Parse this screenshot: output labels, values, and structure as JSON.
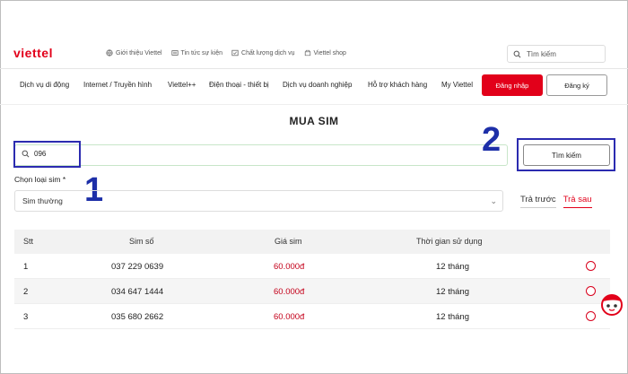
{
  "header": {
    "logo_text": "viettel",
    "top_links": [
      {
        "label": "Giới thiệu Viettel",
        "icon": "globe-icon"
      },
      {
        "label": "Tin tức sự kiện",
        "icon": "news-icon"
      },
      {
        "label": "Chất lượng dịch vụ",
        "icon": "quality-icon"
      },
      {
        "label": "Viettel shop",
        "icon": "shop-icon"
      }
    ],
    "search_placeholder": "Tìm kiếm"
  },
  "nav": {
    "items": [
      "Dịch vụ di động",
      "Internet / Truyền hình",
      "Viettel++",
      "Điện thoại - thiết bị",
      "Dịch vụ doanh nghiệp",
      "Hỗ trợ khách hàng",
      "My Viettel"
    ],
    "login_label": "Đăng nhập",
    "register_label": "Đăng ký"
  },
  "page": {
    "title": "MUA SIM",
    "search_value": "096",
    "search_button": "Tìm kiếm",
    "sim_type_label": "Chọn loại sim *",
    "sim_type_selected": "Sim thường",
    "pay_tabs": [
      {
        "label": "Trả trước",
        "active": false
      },
      {
        "label": "Trả sau",
        "active": true
      }
    ]
  },
  "annotations": [
    "1",
    "2"
  ],
  "table": {
    "headers": [
      "Stt",
      "Sim số",
      "Giá sim",
      "Thời gian sử dụng"
    ],
    "rows": [
      {
        "stt": "1",
        "number": "037 229 0639",
        "price": "60.000đ",
        "duration": "12 tháng"
      },
      {
        "stt": "2",
        "number": "034 647 1444",
        "price": "60.000đ",
        "duration": "12 tháng"
      },
      {
        "stt": "3",
        "number": "035 680 2662",
        "price": "60.000đ",
        "duration": "12 tháng"
      }
    ]
  },
  "colors": {
    "brand": "#e2001a",
    "annotation": "#1d2fa8"
  }
}
